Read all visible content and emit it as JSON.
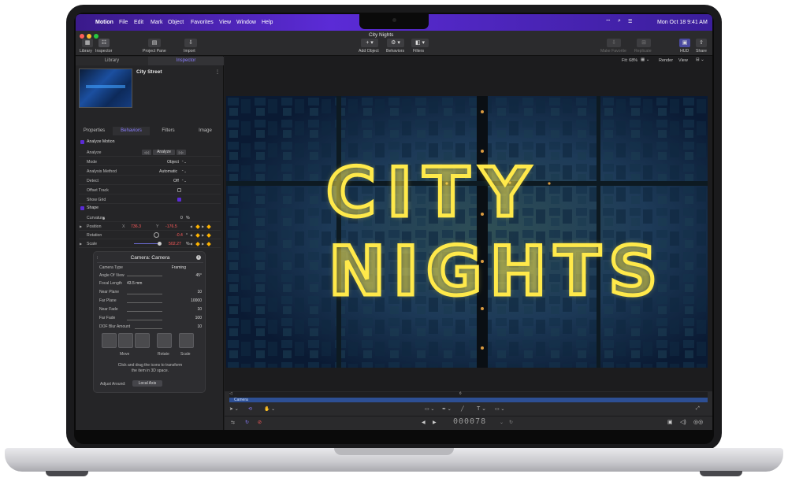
{
  "menubar": {
    "app_name": "Motion",
    "items": [
      "File",
      "Edit",
      "Mark",
      "Object",
      "Favorites",
      "View",
      "Window",
      "Help"
    ],
    "datetime": "Mon Oct 18  9:41 AM"
  },
  "toolbar": {
    "project_title": "City Nights",
    "library_label": "Library",
    "inspector_label": "Inspector",
    "project_pane_label": "Project Pane",
    "import_label": "Import",
    "add_object_label": "Add Object",
    "behaviors_label": "Behaviors",
    "filters_label": "Filters",
    "make_favorite_label": "Make Favorite",
    "replicate_label": "Replicate",
    "hud_label": "HUD",
    "share_label": "Share"
  },
  "left_pane": {
    "top_tabs": [
      "Library",
      "Inspector"
    ],
    "active_top_tab": "Inspector",
    "object_name": "City Street",
    "inspector_tabs": [
      "Properties",
      "Behaviors",
      "Filters",
      "Image"
    ],
    "active_inspector_tab": "Behaviors",
    "sections": {
      "analyze_motion": "Analyze Motion",
      "shape": "Shape"
    },
    "analyze": {
      "label": "Analyze",
      "button": "Analyze",
      "back_button": "◁◁",
      "forward_button": "▷▷"
    },
    "rows": [
      {
        "label": "Mode",
        "value": "Object"
      },
      {
        "label": "Analysis Method",
        "value": "Automatic"
      },
      {
        "label": "Detect",
        "value": "Off"
      },
      {
        "label": "Offset Track",
        "value": ""
      },
      {
        "label": "Show Grid",
        "value": ""
      }
    ],
    "curvature": {
      "label": "Curvature",
      "value": "0",
      "unit": "%"
    },
    "position": {
      "label": "Position",
      "x_label": "X",
      "x": "736.3",
      "y_label": "Y",
      "y": "-176.5"
    },
    "rotation": {
      "label": "Rotation",
      "value": "-0.4",
      "unit": "°"
    },
    "scale": {
      "label": "Scale",
      "value": "502.27",
      "unit": "%"
    }
  },
  "hud": {
    "title": "Camera: Camera",
    "rows": [
      {
        "label": "Camera Type",
        "value": "Framing"
      },
      {
        "label": "Angle Of View",
        "value": "45°"
      },
      {
        "label": "Focal Length",
        "value": "43.5 mm"
      },
      {
        "label": "Near Plane",
        "value": "10"
      },
      {
        "label": "Far Plane",
        "value": "10000"
      },
      {
        "label": "Near Fade",
        "value": "10"
      },
      {
        "label": "Far Fade",
        "value": "100"
      },
      {
        "label": "DOF Blur Amount",
        "value": "10"
      }
    ],
    "tool_labels": {
      "move": "Move",
      "rotate": "Rotate",
      "scale": "Scale"
    },
    "help_text_1": "Click and drag the icons to transform",
    "help_text_2": "the item in 3D space.",
    "adjust_around_label": "Adjust Around:",
    "adjust_around_value": "Local Axis"
  },
  "viewer": {
    "fit_label": "Fit: 68%",
    "render_label": "Render",
    "view_label": "View",
    "canvas_text_line1": "CITY",
    "canvas_text_line2": "NIGHTS"
  },
  "timeline": {
    "track_label": "Camera",
    "timecode": "000078"
  },
  "colors": {
    "menubar_accent": "#5b2bd6",
    "neon_text": "#ffe94a",
    "keyframe_diamond": "#ffb300",
    "negative_value": "#ff5b5b"
  }
}
